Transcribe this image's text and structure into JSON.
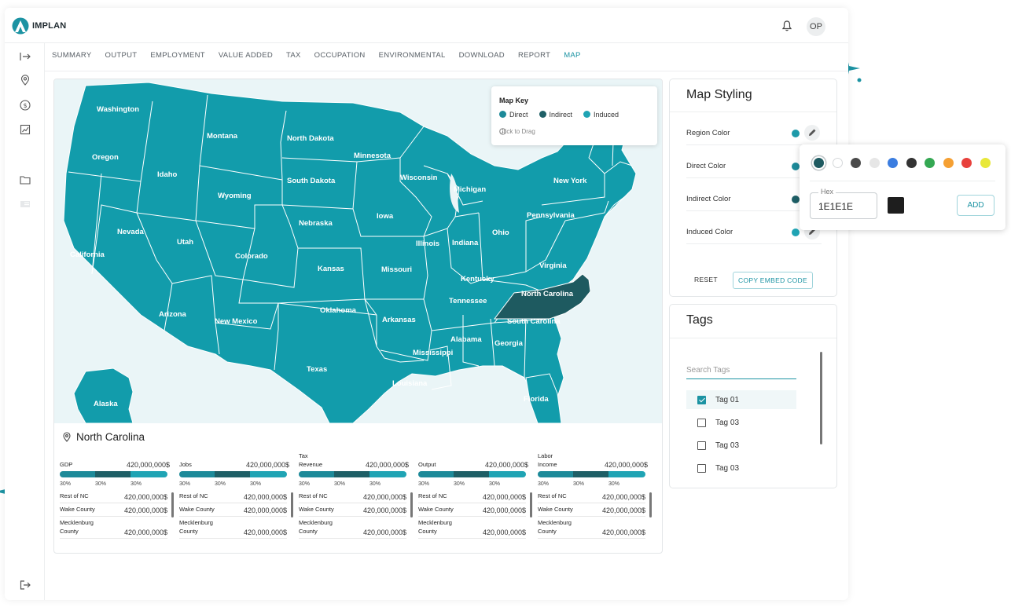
{
  "app": {
    "brand": "IMPLAN",
    "avatar_initials": "OP"
  },
  "nav_tabs": [
    {
      "label": "SUMMARY"
    },
    {
      "label": "OUTPUT"
    },
    {
      "label": "EMPLOYMENT"
    },
    {
      "label": "VALUE ADDED"
    },
    {
      "label": "TAX"
    },
    {
      "label": "OCCUPATION"
    },
    {
      "label": "ENVIRONMENTAL"
    },
    {
      "label": "DOWNLOAD"
    },
    {
      "label": "REPORT"
    },
    {
      "label": "MAP",
      "active": true
    }
  ],
  "sidebar_icons": [
    "expand-arrow-icon",
    "location-pin-icon",
    "dollar-icon",
    "chart-icon",
    "folder-icon",
    "card-icon",
    "logout-icon"
  ],
  "map": {
    "key_title": "Map Key",
    "legend": [
      {
        "label": "Direct",
        "color": "#1d8a99"
      },
      {
        "label": "Indirect",
        "color": "#1e5f66"
      },
      {
        "label": "Induced",
        "color": "#20a4b4"
      }
    ],
    "drag_hint": "Click to Drag",
    "region_color": "#129cab",
    "selected_color": "#1e5a60",
    "selected_state": "North Carolina",
    "states": [
      "Washington",
      "Montana",
      "North Dakota",
      "Minnesota",
      "Oregon",
      "Idaho",
      "South Dakota",
      "Wisconsin",
      "Michigan",
      "New York",
      "Wyoming",
      "Iowa",
      "Pennsylvania",
      "Nebraska",
      "Nevada",
      "Utah",
      "Illinois",
      "Indiana",
      "Ohio",
      "California",
      "Colorado",
      "Kansas",
      "Missouri",
      "Virginia",
      "Kentucky",
      "North Carolina",
      "Tennessee",
      "Oklahoma",
      "Arizona",
      "New Mexico",
      "Arkansas",
      "South Carolina",
      "Alabama",
      "Georgia",
      "Mississippi",
      "Texas",
      "Louisiana",
      "Alaska",
      "Florida"
    ]
  },
  "region": {
    "name": "North Carolina",
    "metrics": [
      {
        "name": "GDP",
        "value": "420,000,000$",
        "pcts": [
          "30%",
          "30%",
          "30%"
        ],
        "rows": [
          {
            "name": "Rest of NC",
            "value": "420,000,000$"
          },
          {
            "name": "Wake County",
            "value": "420,000,000$"
          },
          {
            "name": "Mecklenburg County",
            "value": "420,000,000$"
          }
        ]
      },
      {
        "name": "Jobs",
        "value": "420,000,000$",
        "pcts": [
          "30%",
          "30%",
          "30%"
        ],
        "rows": [
          {
            "name": "Rest of NC",
            "value": "420,000,000$"
          },
          {
            "name": "Wake County",
            "value": "420,000,000$"
          },
          {
            "name": "Mecklenburg County",
            "value": "420,000,000$"
          }
        ]
      },
      {
        "name": "Tax Revenue",
        "value": "420,000,000$",
        "pcts": [
          "30%",
          "30%",
          "30%"
        ],
        "rows": [
          {
            "name": "Rest of NC",
            "value": "420,000,000$"
          },
          {
            "name": "Wake County",
            "value": "420,000,000$"
          },
          {
            "name": "Mecklenburg County",
            "value": "420,000,000$"
          }
        ]
      },
      {
        "name": "Output",
        "value": "420,000,000$",
        "pcts": [
          "30%",
          "30%",
          "30%"
        ],
        "rows": [
          {
            "name": "Rest of NC",
            "value": "420,000,000$"
          },
          {
            "name": "Wake County",
            "value": "420,000,000$"
          },
          {
            "name": "Mecklenburg County",
            "value": "420,000,000$"
          }
        ]
      },
      {
        "name": "Labor Income",
        "value": "420,000,000$",
        "pcts": [
          "30%",
          "30%",
          "30%"
        ],
        "rows": [
          {
            "name": "Rest of NC",
            "value": "420,000,000$"
          },
          {
            "name": "Wake County",
            "value": "420,000,000$"
          },
          {
            "name": "Mecklenburg County",
            "value": "420,000,000$"
          }
        ]
      }
    ]
  },
  "styling": {
    "title": "Map Styling",
    "rows": [
      {
        "label": "Region Color",
        "color": "#1d9aa9"
      },
      {
        "label": "Direct Color",
        "color": "#1d8a99"
      },
      {
        "label": "Indirect Color",
        "color": "#1e5f66"
      },
      {
        "label": "Induced Color",
        "color": "#20a4b4"
      }
    ],
    "reset_label": "RESET",
    "embed_label": "COPY EMBED CODE"
  },
  "picker": {
    "swatches": [
      "#1e5a60",
      "#ffffff",
      "#4a4a4a",
      "#e6e6e6",
      "#3b7de0",
      "#333333",
      "#34a853",
      "#f5a033",
      "#e8413c",
      "#e8e83a"
    ],
    "hex_label": "Hex",
    "hex_value": "1E1E1E",
    "preview_color": "#1e1e1e",
    "add_label": "ADD"
  },
  "tags": {
    "title": "Tags",
    "search_placeholder": "Search Tags",
    "items": [
      {
        "label": "Tag 01",
        "checked": true
      },
      {
        "label": "Tag 03",
        "checked": false
      },
      {
        "label": "Tag 03",
        "checked": false
      },
      {
        "label": "Tag 03",
        "checked": false
      }
    ]
  }
}
